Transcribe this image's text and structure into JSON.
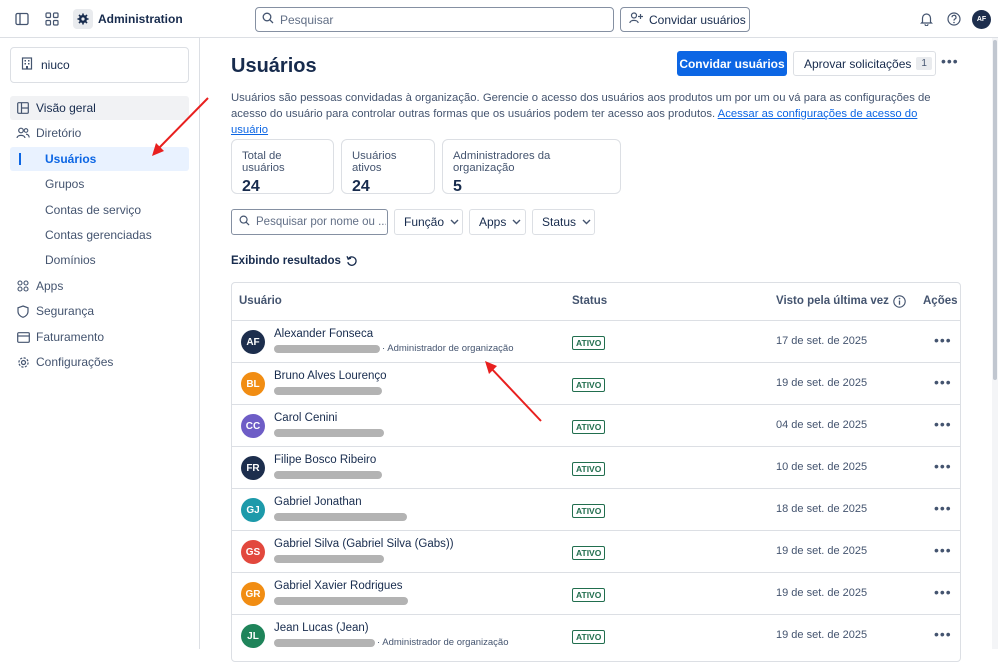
{
  "topbar": {
    "app_title": "Administration",
    "search_placeholder": "Pesquisar",
    "invite_label": "Convidar usuários",
    "user_initials": "AF"
  },
  "sidebar": {
    "org_name": "niuco",
    "items": [
      {
        "label": "Visão geral",
        "icon": "layout-icon"
      },
      {
        "label": "Diretório",
        "icon": "people-icon"
      },
      {
        "label": "Usuários"
      },
      {
        "label": "Grupos"
      },
      {
        "label": "Contas de serviço"
      },
      {
        "label": "Contas gerenciadas"
      },
      {
        "label": "Domínios"
      },
      {
        "label": "Apps",
        "icon": "apps-icon"
      },
      {
        "label": "Segurança",
        "icon": "shield-icon"
      },
      {
        "label": "Faturamento",
        "icon": "billing-icon"
      },
      {
        "label": "Configurações",
        "icon": "gear-icon"
      }
    ]
  },
  "main": {
    "title": "Usuários",
    "invite_button": "Convidar usuários",
    "approve_button": "Aprovar solicitações",
    "approve_count": "1",
    "description": "Usuários são pessoas convidadas à organização. Gerencie o acesso dos usuários aos produtos um por um ou vá para as configurações de acesso do usuário para controlar outras formas que os usuários podem ter acesso aos produtos.",
    "description_link": "Acessar as configurações de acesso do usuário",
    "stats": [
      {
        "label": "Total de usuários",
        "value": "24"
      },
      {
        "label": "Usuários ativos",
        "value": "24"
      },
      {
        "label": "Administradores da organização",
        "value": "5"
      }
    ],
    "filter_placeholder": "Pesquisar por nome ou ...",
    "filters": [
      "Função",
      "Apps",
      "Status"
    ],
    "results_label": "Exibindo resultados"
  },
  "table": {
    "headers": {
      "user": "Usuário",
      "status": "Status",
      "last_seen": "Visto pela última vez",
      "actions": "Ações"
    },
    "rows": [
      {
        "initials": "AF",
        "name": "Alexander Fonseca",
        "role": "· Administrador de organização",
        "status": "ATIVO",
        "last_seen": "17 de set. de 2025",
        "color": "#1d2e4d"
      },
      {
        "initials": "BL",
        "name": "Bruno Alves Lourenço",
        "role": "",
        "status": "ATIVO",
        "last_seen": "19 de set. de 2025",
        "color": "#f18d13"
      },
      {
        "initials": "CC",
        "name": "Carol Cenini",
        "role": "",
        "status": "ATIVO",
        "last_seen": "04 de set. de 2025",
        "color": "#6e5dc6"
      },
      {
        "initials": "FR",
        "name": "Filipe Bosco Ribeiro",
        "role": "",
        "status": "ATIVO",
        "last_seen": "10 de set. de 2025",
        "color": "#1d2e4d"
      },
      {
        "initials": "GJ",
        "name": "Gabriel Jonathan",
        "role": "",
        "status": "ATIVO",
        "last_seen": "18 de set. de 2025",
        "color": "#1d9aaa"
      },
      {
        "initials": "GS",
        "name": "Gabriel Silva (Gabriel Silva (Gabs))",
        "role": "",
        "status": "ATIVO",
        "last_seen": "19 de set. de 2025",
        "color": "#e2483d"
      },
      {
        "initials": "GR",
        "name": "Gabriel Xavier Rodrigues",
        "role": "",
        "status": "ATIVO",
        "last_seen": "19 de set. de 2025",
        "color": "#f18d13"
      },
      {
        "initials": "JL",
        "name": "Jean Lucas (Jean)",
        "role": "· Administrador de organização",
        "status": "ATIVO",
        "last_seen": "19 de set. de 2025",
        "color": "#1f845a"
      }
    ]
  }
}
